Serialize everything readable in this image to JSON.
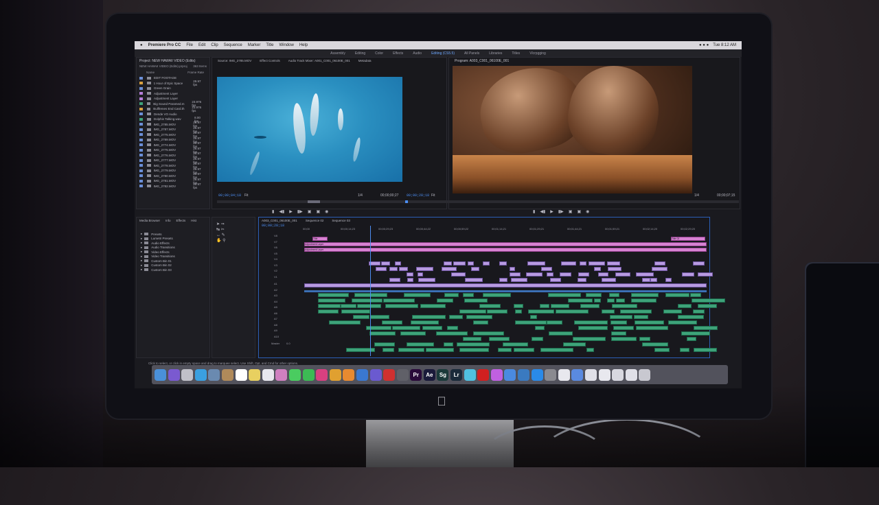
{
  "menubar": {
    "app": "Premiere Pro CC",
    "items": [
      "File",
      "Edit",
      "Clip",
      "Sequence",
      "Marker",
      "Title",
      "Window",
      "Help"
    ],
    "clock": "Tue 8:12 AM"
  },
  "workspaces": {
    "items": [
      "Assembly",
      "Editing",
      "Color",
      "Effects",
      "Audio",
      "Editing (CS5.5)",
      "All Panels",
      "Libraries",
      "Titles",
      "Vlcrpgging"
    ],
    "active_index": 5
  },
  "project": {
    "title": "Project: NEW HAWAII VIDEO (Edits)",
    "path": "NEW HAWAII VIDEO (Edits).prproj",
    "items_count": "363 Items",
    "col_name": "Name",
    "col_rate": "Frame Rate",
    "rows": [
      {
        "name": "EDIT FOOTAGE",
        "fps": "",
        "color": "#6b8fd8",
        "folder": true
      },
      {
        "name": "1 Hour of Epic Space",
        "fps": "29.97 fps",
        "color": "#d7a040"
      },
      {
        "name": "Green Grain",
        "fps": "",
        "color": "#6b8fd8"
      },
      {
        "name": "Adjustment Layer",
        "fps": "",
        "color": "#b57ed8"
      },
      {
        "name": "Adjustment Layer",
        "fps": "",
        "color": "#b57ed8"
      },
      {
        "name": "Big Sound Paramed.m",
        "fps": "23.976 fps",
        "color": "#3ea37a"
      },
      {
        "name": "Bullfrenes End Card.th",
        "fps": "23.976 fps",
        "color": "#d7a040"
      },
      {
        "name": "Dende VO Audio",
        "fps": "",
        "color": "#6b8fd8"
      },
      {
        "name": "Dolphin Talking.wav",
        "fps": "8.00 fps",
        "color": "#3ea37a"
      },
      {
        "name": "IMG_2785.MOV",
        "fps": "29.97 fps",
        "color": "#6b8fd8"
      },
      {
        "name": "IMG_2787.MOV",
        "fps": "29.97 fps",
        "color": "#6b8fd8"
      },
      {
        "name": "IMG_2775.MOV",
        "fps": "29.97 fps",
        "color": "#6b8fd8"
      },
      {
        "name": "IMG_2789.MOV",
        "fps": "29.97 fps",
        "color": "#6b8fd8"
      },
      {
        "name": "IMG_2774.MOV",
        "fps": "29.97 fps",
        "color": "#6b8fd8"
      },
      {
        "name": "IMG_2775.MOV",
        "fps": "29.97 fps",
        "color": "#6b8fd8"
      },
      {
        "name": "IMG_2776.MOV",
        "fps": "29.97 fps",
        "color": "#6b8fd8"
      },
      {
        "name": "IMG_2777.MOV",
        "fps": "29.97 fps",
        "color": "#6b8fd8"
      },
      {
        "name": "IMG_2778.MOV",
        "fps": "29.97 fps",
        "color": "#6b8fd8"
      },
      {
        "name": "IMG_2779.MOV",
        "fps": "29.97 fps",
        "color": "#6b8fd8"
      },
      {
        "name": "IMG_2780.MOV",
        "fps": "29.97 fps",
        "color": "#6b8fd8"
      },
      {
        "name": "IMG_2781.MOV",
        "fps": "29.97 fps",
        "color": "#6b8fd8"
      },
      {
        "name": "IMG_2782.MOV",
        "fps": "29.97 fps",
        "color": "#6b8fd8"
      }
    ]
  },
  "source_monitor": {
    "tabs": [
      "Source: IMG_2785.MOV",
      "Effect Controls",
      "Audio Track Mixer: A001_C001_06100E_001",
      "Metadata"
    ],
    "timecode_in": "00;00;04;18",
    "fit": "Fit",
    "scale": "1/4",
    "timecode_out": "00;00;00;27"
  },
  "program_monitor": {
    "title": "Program: A003_C001_06100E_001",
    "timecode_in": "00;00;28;18",
    "fit": "Fit",
    "scale": "1/4",
    "timecode_out": "00;00;07;15"
  },
  "effects": {
    "tabs": [
      "Media Browser",
      "Info",
      "Effects",
      "Hist"
    ],
    "rows": [
      "Presets",
      "Lumetri Presets",
      "Audio Effects",
      "Audio Transitions",
      "Video Effects",
      "Video Transitions",
      "Custom Bin 01",
      "Custom Bin 02",
      "Custom Bin 03"
    ]
  },
  "timeline": {
    "tabs": [
      "A003_C001_06100E_001",
      "Sequence 02",
      "Sequence 03"
    ],
    "timecode": "00;00;28;18",
    "ruler": [
      "00;00",
      "00;00;14;23",
      "00;00;29;23",
      "00;00;44;22",
      "00;00;59;22",
      "00;01;14;21",
      "00;01;29;21",
      "00;01;44;21",
      "00;01;59;21",
      "00;02;14;20",
      "00;02;29;20"
    ],
    "video_tracks": [
      "V8",
      "V7",
      "V6",
      "V5",
      "V4",
      "V3",
      "V2",
      "V1"
    ],
    "audio_tracks": [
      "A1",
      "A2",
      "A3",
      "A4",
      "A5",
      "A6",
      "A7",
      "A8",
      "A9",
      "A10"
    ],
    "master": "Master",
    "master_val": "0.0",
    "pink_title": "Title",
    "pink_title2": "Title 02",
    "adj_label": "Adjustment Layer"
  },
  "status": "Click to select, or click in empty space and drag to marquee select. Use Shift, Opt, and Cmd for other options.",
  "dock": {
    "icons": [
      {
        "name": "finder-icon",
        "glyph": "",
        "color": "#4a90d9"
      },
      {
        "name": "siri-icon",
        "glyph": "",
        "color": "#7a5ad0"
      },
      {
        "name": "launchpad-icon",
        "glyph": "",
        "color": "#c0c0c8"
      },
      {
        "name": "safari-icon",
        "glyph": "",
        "color": "#3aa0e0"
      },
      {
        "name": "preview-icon",
        "glyph": "",
        "color": "#6a8ab0"
      },
      {
        "name": "contacts-icon",
        "glyph": "",
        "color": "#b08a5a"
      },
      {
        "name": "calendar-icon",
        "glyph": "8",
        "color": "#ffffff"
      },
      {
        "name": "notes-icon",
        "glyph": "",
        "color": "#e8d060"
      },
      {
        "name": "reminders-icon",
        "glyph": "",
        "color": "#e8e8ee"
      },
      {
        "name": "photos-icon",
        "glyph": "",
        "color": "#d080c0"
      },
      {
        "name": "messages-icon",
        "glyph": "",
        "color": "#4acc60"
      },
      {
        "name": "facetime-icon",
        "glyph": "",
        "color": "#3cba54"
      },
      {
        "name": "itunes-icon",
        "glyph": "",
        "color": "#d84080"
      },
      {
        "name": "chrome-icon",
        "glyph": "",
        "color": "#e0a030"
      },
      {
        "name": "pages-icon",
        "glyph": "",
        "color": "#e88a30"
      },
      {
        "name": "keynote-icon",
        "glyph": "",
        "color": "#3a78d0"
      },
      {
        "name": "imovie-icon",
        "glyph": "",
        "color": "#6a5ad0"
      },
      {
        "name": "dvd-icon",
        "glyph": "",
        "color": "#d03030"
      },
      {
        "name": "resolve-icon",
        "glyph": "",
        "color": "#606068"
      },
      {
        "name": "premiere-icon",
        "glyph": "Pr",
        "color": "#2a0a3a"
      },
      {
        "name": "aftereffects-icon",
        "glyph": "Ae",
        "color": "#1a1a3a"
      },
      {
        "name": "speedgrade-icon",
        "glyph": "Sg",
        "color": "#1a3a3a"
      },
      {
        "name": "lightroom-icon",
        "glyph": "Lr",
        "color": "#1a2a3a"
      },
      {
        "name": "atom-icon",
        "glyph": "",
        "color": "#50c0e0"
      },
      {
        "name": "creative-cloud-icon",
        "glyph": "",
        "color": "#d02020"
      },
      {
        "name": "music-icon",
        "glyph": "",
        "color": "#c060e0"
      },
      {
        "name": "keynote2-icon",
        "glyph": "",
        "color": "#4a8ae0"
      },
      {
        "name": "finder2-icon",
        "glyph": "",
        "color": "#3a7ac0"
      },
      {
        "name": "appstore-icon",
        "glyph": "",
        "color": "#2a8ae8"
      },
      {
        "name": "settings-icon",
        "glyph": "",
        "color": "#8a8a90"
      },
      {
        "name": "file-icon",
        "glyph": "",
        "color": "#e8e8ee"
      },
      {
        "name": "folder-icon",
        "glyph": "",
        "color": "#5a8ae0"
      },
      {
        "name": "file2-icon",
        "glyph": "",
        "color": "#e0e0e8"
      },
      {
        "name": "file3-icon",
        "glyph": "",
        "color": "#e8e8ee"
      },
      {
        "name": "file4-icon",
        "glyph": "",
        "color": "#d8d8e0"
      },
      {
        "name": "file5-icon",
        "glyph": "",
        "color": "#e0e0e8"
      },
      {
        "name": "trash-icon",
        "glyph": "",
        "color": "#c8c8d0"
      }
    ]
  },
  "colors": {
    "accent": "#4d8ef2",
    "timecode": "#4d8ef2"
  }
}
